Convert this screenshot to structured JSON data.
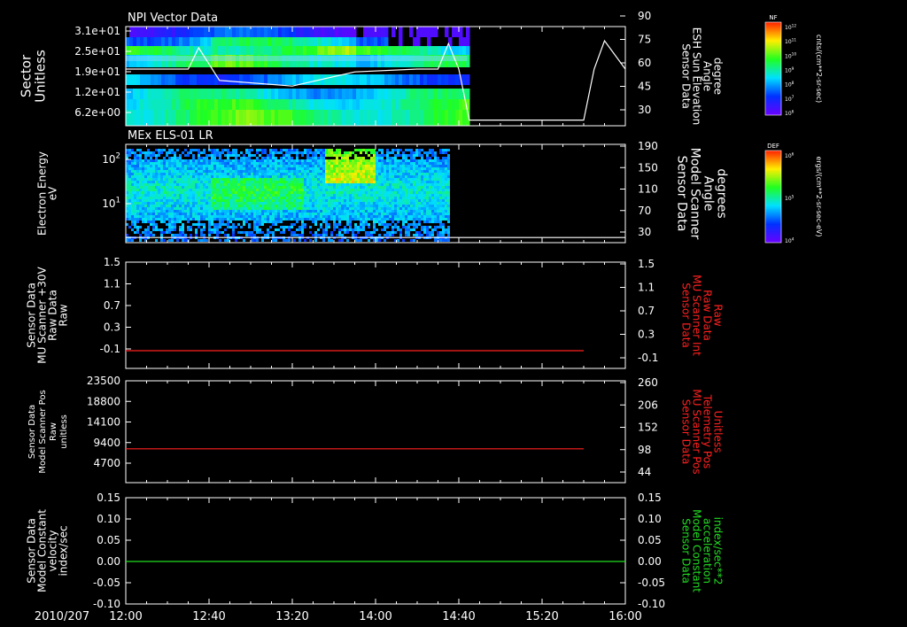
{
  "date_label": "2010/207",
  "time_ticks": [
    "12:00",
    "12:40",
    "13:20",
    "14:00",
    "14:40",
    "15:20",
    "16:00"
  ],
  "panels": [
    {
      "title": "NPI Vector Data",
      "left_label": [
        "Sector",
        "Unitless"
      ],
      "left_ticks": [
        "3.1e+01",
        "2.5e+01",
        "1.9e+01",
        "1.2e+01",
        "6.2e+00"
      ],
      "right_label": [
        "Sensor Data",
        "ESH Sun Elevation",
        "Angle",
        "degree"
      ],
      "right_label_color": "#ffffff",
      "right_ticks": [
        "90",
        "75",
        "60",
        "45",
        "30"
      ],
      "colorbar": {
        "title": "NF",
        "label": "cnts/(cm**2-sr-sec)",
        "ticks": [
          "10^12",
          "10^11",
          "10^10",
          "10^9",
          "10^8",
          "10^7",
          "10^6"
        ]
      }
    },
    {
      "title": "MEx ELS-01 LR",
      "left_label": [
        "Electron Energy",
        "eV"
      ],
      "left_ticks": [
        "10^2",
        "10^1"
      ],
      "right_label": [
        "Sensor Data",
        "Model Scanner",
        "Angle",
        "degrees"
      ],
      "right_label_color": "#ffffff",
      "right_ticks": [
        "190",
        "150",
        "110",
        "70",
        "30"
      ],
      "colorbar": {
        "title": "DEF",
        "label": "ergs/(cm**2-sr-sec-eV)",
        "ticks": [
          "10^6",
          "10^5",
          "10^4"
        ]
      }
    },
    {
      "title": "",
      "left_label": [
        "Sensor Data",
        "MU Scanner +30V",
        "Raw Data",
        "Raw"
      ],
      "left_ticks": [
        "1.5",
        "1.1",
        "0.7",
        "0.3",
        "-0.1"
      ],
      "right_label": [
        "Sensor Data",
        "MU Scanner Int",
        "Raw Data",
        "Raw"
      ],
      "right_label_color": "#ff2020",
      "right_ticks": [
        "1.5",
        "1.1",
        "0.7",
        "0.3",
        "-0.1"
      ]
    },
    {
      "title": "",
      "left_label": [
        "Sensor Data",
        "Model Scanner Pos",
        "Raw",
        "unitless"
      ],
      "left_ticks": [
        "23500",
        "18800",
        "14100",
        "9400",
        "4700"
      ],
      "right_label": [
        "Sensor Data",
        "MU Scanner Pos",
        "Telemetry Pos",
        "Unitless"
      ],
      "right_label_color": "#ff2020",
      "right_ticks": [
        "260",
        "206",
        "152",
        "98",
        "44"
      ]
    },
    {
      "title": "",
      "left_label": [
        "Sensor Data",
        "Model Constant",
        "velocity",
        "index/sec"
      ],
      "left_ticks": [
        "0.15",
        "0.10",
        "0.05",
        "0.00",
        "-0.05",
        "-0.10"
      ],
      "right_label": [
        "Sensor Data",
        "Model Constant",
        "acceleration",
        "index/sec**2"
      ],
      "right_label_color": "#22dd22",
      "right_ticks": [
        "0.15",
        "0.10",
        "0.05",
        "0.00",
        "-0.05",
        "-0.10"
      ]
    }
  ],
  "chart_data": [
    {
      "type": "heatmap",
      "title": "NPI Vector Data",
      "ylabel": "Sector Unitless",
      "overlay_line": {
        "name": "ESH Sun Elevation Angle",
        "y_axis": "right",
        "ylim": [
          20,
          90
        ],
        "x": [
          "12:00",
          "12:20",
          "12:30",
          "12:35",
          "12:45",
          "13:20",
          "13:50",
          "14:20",
          "14:30",
          "14:35",
          "14:40",
          "14:45",
          "15:20",
          "15:40",
          "15:45",
          "15:50",
          "16:00"
        ],
        "values": [
          60,
          60,
          60,
          75,
          52,
          48,
          58,
          60,
          60,
          78,
          60,
          24,
          24,
          24,
          60,
          80,
          60
        ]
      }
    },
    {
      "type": "heatmap",
      "title": "MEx ELS-01 LR",
      "ylabel": "Electron Energy eV",
      "yscale": "log",
      "data_end": "14:35",
      "note": "Enhanced flux near 13:40-14:00 at ~10^2 eV",
      "overlay_line": {
        "name": "Model Scanner Angle",
        "y_axis": "right",
        "ylim": [
          0,
          190
        ],
        "x": [
          "12:00",
          "16:00"
        ],
        "values": [
          10,
          10
        ]
      }
    },
    {
      "type": "line",
      "series": [
        {
          "name": "MU Scanner Int Raw Data",
          "color": "#ff2020",
          "x": [
            "12:00",
            "15:40"
          ],
          "values": [
            0.0,
            0.0
          ]
        }
      ],
      "ylim": [
        -0.3,
        1.5
      ]
    },
    {
      "type": "line",
      "series": [
        {
          "name": "MU Scanner Pos Telemetry Pos",
          "color": "#ff2020",
          "x": [
            "12:00",
            "15:40"
          ],
          "values": [
            7800,
            7800
          ]
        }
      ],
      "ylim": [
        0,
        23500
      ]
    },
    {
      "type": "line",
      "series": [
        {
          "name": "Model Constant acceleration",
          "color": "#22dd22",
          "x": [
            "12:00",
            "16:00"
          ],
          "values": [
            0.0,
            0.0
          ]
        }
      ],
      "ylim": [
        -0.1,
        0.15
      ]
    }
  ]
}
